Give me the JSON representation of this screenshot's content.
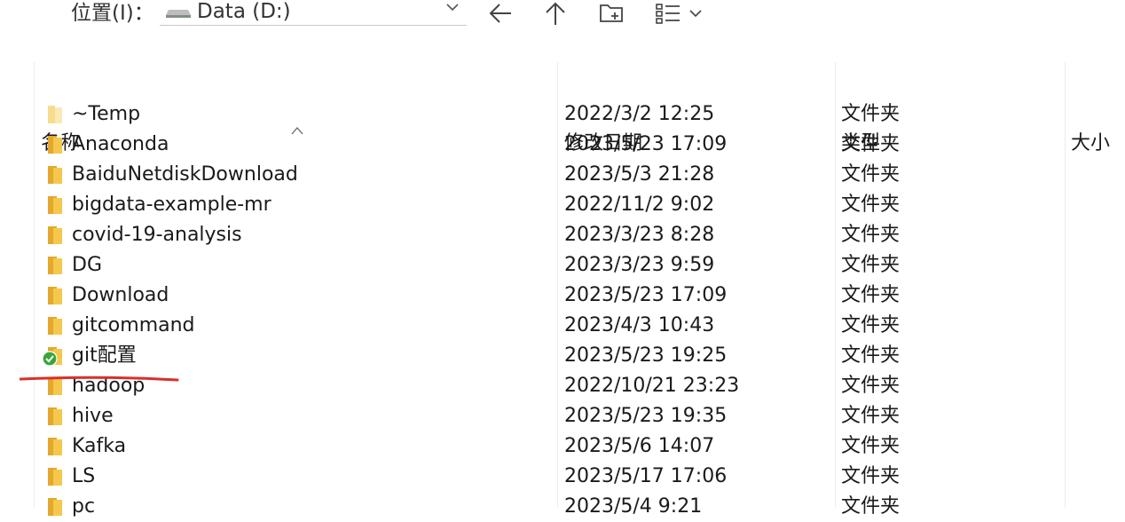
{
  "toolbar": {
    "location_label": "位置(I)：",
    "location_value": "Data (D:)",
    "icons": [
      "drive-icon",
      "chevron-down-icon",
      "back-arrow-icon",
      "up-arrow-icon",
      "new-folder-icon",
      "view-options-icon"
    ]
  },
  "columns": {
    "name": "名称",
    "modified": "修改日期",
    "type": "类型",
    "size": "大小"
  },
  "rows": [
    {
      "name": "~Temp",
      "modified": "2022/3/2 12:25",
      "type": "文件夹",
      "icon": "folder-empty-icon"
    },
    {
      "name": "Anaconda",
      "modified": "2023/5/23 17:09",
      "type": "文件夹",
      "icon": "folder-icon"
    },
    {
      "name": "BaiduNetdiskDownload",
      "modified": "2023/5/3 21:28",
      "type": "文件夹",
      "icon": "folder-icon"
    },
    {
      "name": "bigdata-example-mr",
      "modified": "2022/11/2 9:02",
      "type": "文件夹",
      "icon": "folder-icon"
    },
    {
      "name": "covid-19-analysis",
      "modified": "2023/3/23 8:28",
      "type": "文件夹",
      "icon": "folder-icon"
    },
    {
      "name": "DG",
      "modified": "2023/3/23 9:59",
      "type": "文件夹",
      "icon": "folder-icon"
    },
    {
      "name": "Download",
      "modified": "2023/5/23 17:09",
      "type": "文件夹",
      "icon": "folder-icon"
    },
    {
      "name": "gitcommand",
      "modified": "2023/4/3 10:43",
      "type": "文件夹",
      "icon": "folder-icon"
    },
    {
      "name": "git配置",
      "modified": "2023/5/23 19:25",
      "type": "文件夹",
      "icon": "synced-check-icon"
    },
    {
      "name": "hadoop",
      "modified": "2022/10/21 23:23",
      "type": "文件夹",
      "icon": "folder-icon"
    },
    {
      "name": "hive",
      "modified": "2023/5/23 19:35",
      "type": "文件夹",
      "icon": "folder-icon"
    },
    {
      "name": "Kafka",
      "modified": "2023/5/6 14:07",
      "type": "文件夹",
      "icon": "folder-icon"
    },
    {
      "name": "LS",
      "modified": "2023/5/17 17:06",
      "type": "文件夹",
      "icon": "folder-icon"
    },
    {
      "name": "pc",
      "modified": "2023/5/4 9:21",
      "type": "文件夹",
      "icon": "folder-icon"
    }
  ],
  "colors": {
    "folder": "#f0c24a",
    "folder_dark": "#e3a82d",
    "sync_check": "#3aa53a",
    "annotation_line": "#d9302a"
  }
}
